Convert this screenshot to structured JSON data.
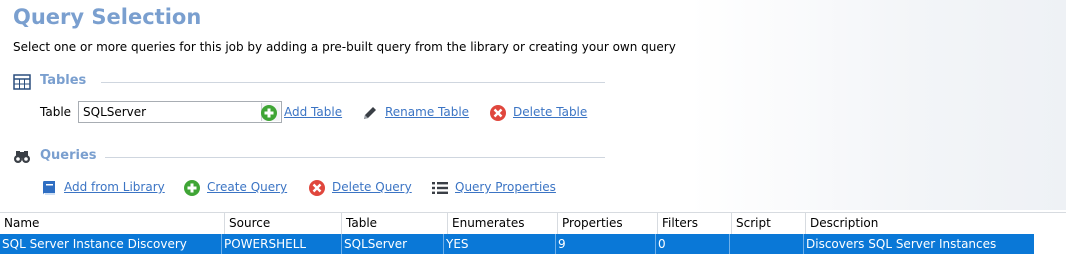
{
  "page": {
    "title": "Query Selection",
    "subtitle": "Select one or more queries for this job by adding a pre-built query from the library or creating your own query"
  },
  "tables_section": {
    "label": "Tables",
    "table_label": "Table",
    "selected_table": "SQLServer",
    "add_label": "Add Table",
    "rename_label": "Rename Table",
    "delete_label": "Delete Table"
  },
  "queries_section": {
    "label": "Queries",
    "add_library_label": "Add from Library",
    "create_label": "Create Query",
    "delete_label": "Delete Query",
    "properties_label": "Query Properties"
  },
  "grid": {
    "columns": [
      "Name",
      "Source",
      "Table",
      "Enumerates",
      "Properties",
      "Filters",
      "Script",
      "Description"
    ],
    "rows": [
      [
        "SQL Server Instance Discovery",
        "POWERSHELL",
        "SQLServer",
        "YES",
        "9",
        "0",
        "",
        "Discovers SQL Server Instances"
      ]
    ]
  },
  "colors": {
    "accent": "#7a9fcf",
    "link": "#3b74c4",
    "selection": "#0a78d7",
    "add_green": "#3fa535",
    "delete_red": "#e0473d"
  },
  "icons": {
    "tables": "table-grid-icon",
    "queries": "binoculars-icon",
    "add": "plus-circle-icon",
    "rename": "pencil-icon",
    "delete": "x-circle-icon",
    "library": "book-icon",
    "properties": "list-icon"
  }
}
